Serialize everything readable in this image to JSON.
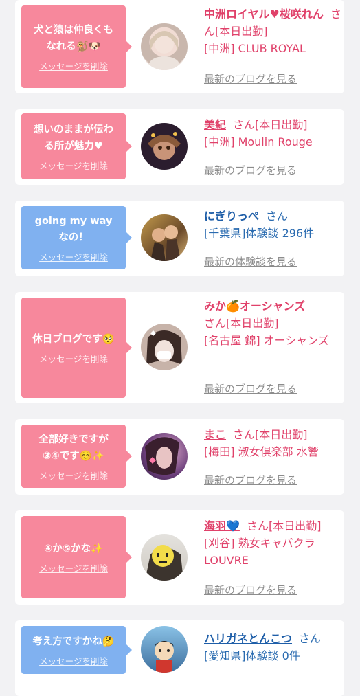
{
  "colors": {
    "page_bg": "#f2f2f4",
    "pink_bubble": "#f7889c",
    "blue_bubble": "#80b1f0",
    "pink_text": "#e0416a",
    "blue_text": "#2a6bb0",
    "link_gray": "#8c8c8c"
  },
  "delete_label": "メッセージを削除",
  "honorific": "さん",
  "cards": [
    {
      "message": "犬と猿は仲良くも\nなれる🐒🐶",
      "name": "中洲ロイヤル♥桜咲れん",
      "status": "[本日出勤]",
      "location": "[中洲] CLUB ROYAL",
      "link": "最新のブログを見る"
    },
    {
      "message": "想いのままが伝わ\nる所が魅力♥",
      "name": "美紀",
      "status": "[本日出勤]",
      "location": "[中洲] Moulin Rouge",
      "link": "最新のブログを見る"
    },
    {
      "message": "going my way\nなの！",
      "name": "にぎりっぺ",
      "status": "",
      "location": "[千葉県]体験談 296件",
      "link": "最新の体験談を見る"
    },
    {
      "message": "休日ブログです🥺",
      "name": "みか🍊オーシャンズ",
      "status": "[本日出勤]",
      "location": "[名古屋 錦] オーシャンズ",
      "link": "最新のブログを見る"
    },
    {
      "message": "全部好きですが\n③④です☺️✨",
      "name": "まこ",
      "status": "[本日出勤]",
      "location": "[梅田] 淑女倶楽部 水響",
      "link": "最新のブログを見る"
    },
    {
      "message": "④か⑤かな✨",
      "name": "海羽💙",
      "status": "[本日出勤]",
      "location": "[刈谷] 熟女キャバクラ LOUVRE",
      "link": "最新のブログを見る"
    },
    {
      "message": "考え方ですかね🤔",
      "name": "ハリガネとんこつ",
      "status": "",
      "location": "[愛知県]体験談 0件",
      "link": ""
    }
  ]
}
